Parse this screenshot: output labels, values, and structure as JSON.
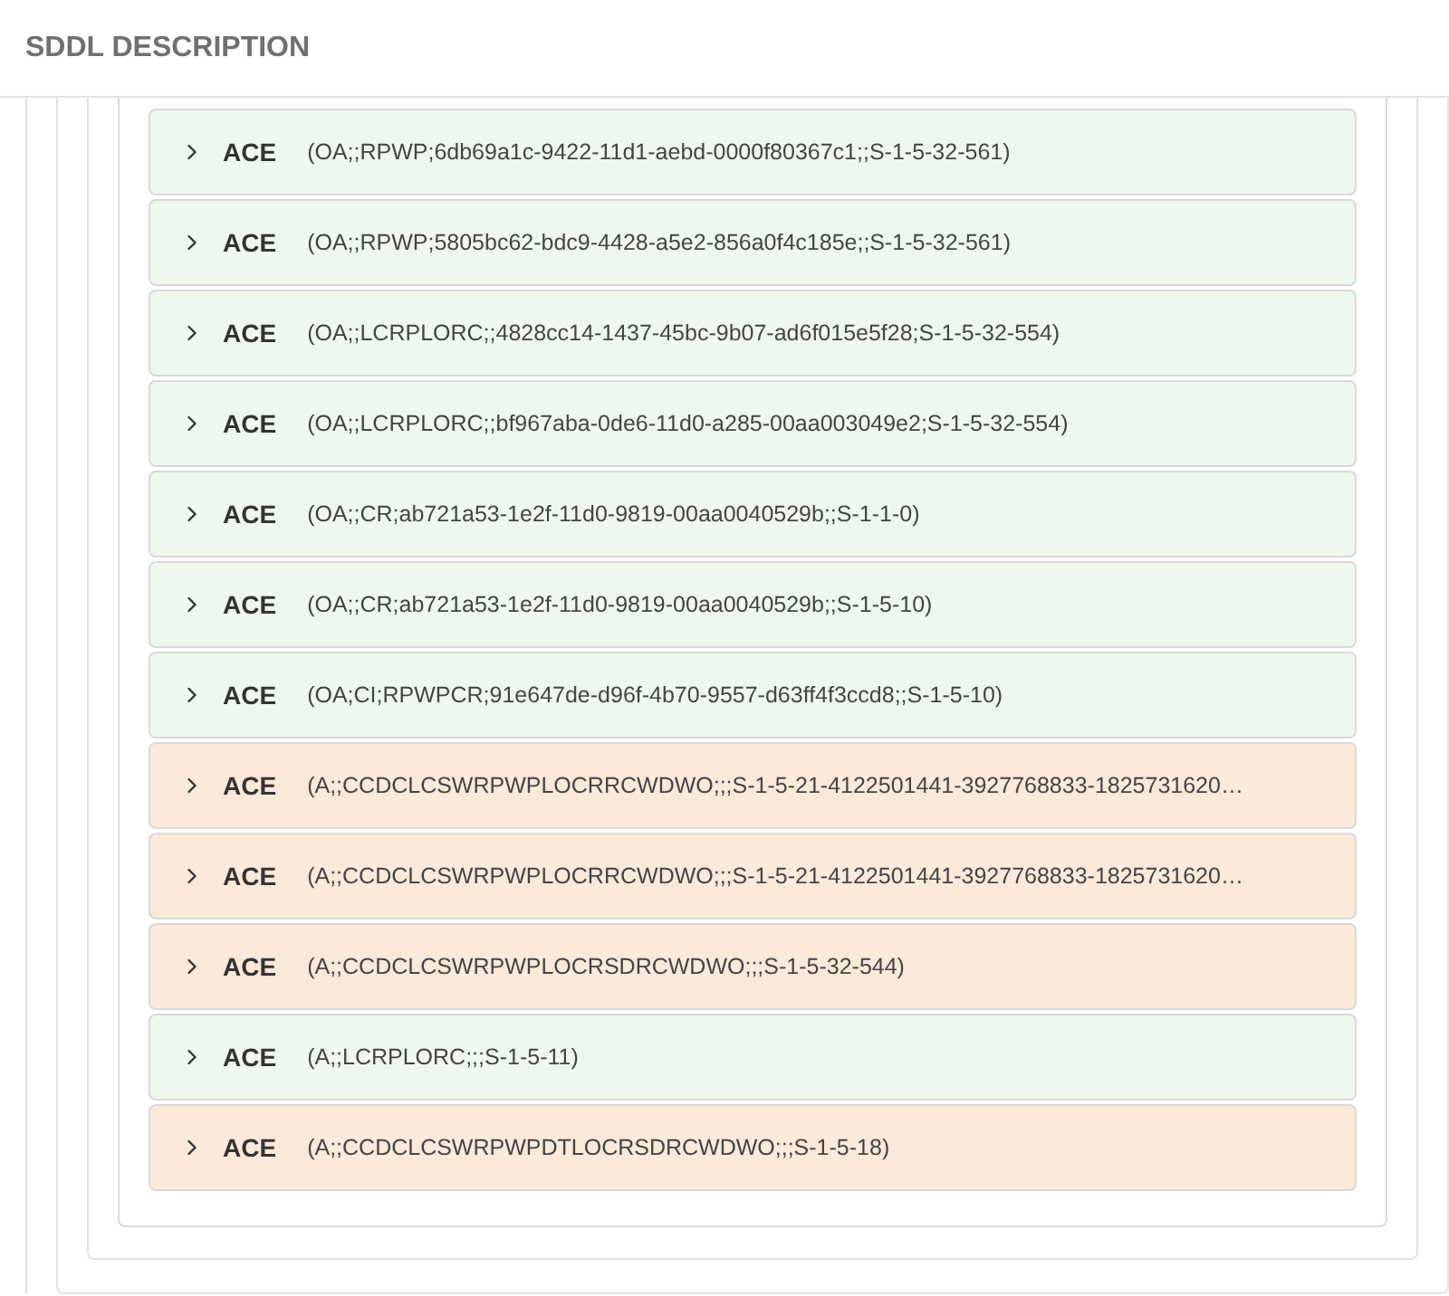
{
  "section": {
    "title": "SDDL DESCRIPTION"
  },
  "aces": [
    {
      "label": "ACE",
      "value": "(OA;;RPWP;6db69a1c-9422-11d1-aebd-0000f80367c1;;S-1-5-32-561)",
      "color": "#eef8ee",
      "expanded": false
    },
    {
      "label": "ACE",
      "value": "(OA;;RPWP;5805bc62-bdc9-4428-a5e2-856a0f4c185e;;S-1-5-32-561)",
      "color": "#eef8ee",
      "expanded": false
    },
    {
      "label": "ACE",
      "value": "(OA;;LCRPLORC;;4828cc14-1437-45bc-9b07-ad6f015e5f28;S-1-5-32-554)",
      "color": "#eef8ee",
      "expanded": false
    },
    {
      "label": "ACE",
      "value": "(OA;;LCRPLORC;;bf967aba-0de6-11d0-a285-00aa003049e2;S-1-5-32-554)",
      "color": "#eef8ee",
      "expanded": false
    },
    {
      "label": "ACE",
      "value": "(OA;;CR;ab721a53-1e2f-11d0-9819-00aa0040529b;;S-1-1-0)",
      "color": "#eef8ee",
      "expanded": false
    },
    {
      "label": "ACE",
      "value": "(OA;;CR;ab721a53-1e2f-11d0-9819-00aa0040529b;;S-1-5-10)",
      "color": "#eef8ee",
      "expanded": false
    },
    {
      "label": "ACE",
      "value": "(OA;CI;RPWPCR;91e647de-d96f-4b70-9557-d63ff4f3ccd8;;S-1-5-10)",
      "color": "#eef8ee",
      "expanded": false
    },
    {
      "label": "ACE",
      "value": "(A;;CCDCLCSWRPWPLOCRRCWDWO;;;S-1-5-21-4122501441-3927768833-1825731620…",
      "color": "#fbe9d9",
      "expanded": false
    },
    {
      "label": "ACE",
      "value": "(A;;CCDCLCSWRPWPLOCRRCWDWO;;;S-1-5-21-4122501441-3927768833-1825731620…",
      "color": "#fbe9d9",
      "expanded": false
    },
    {
      "label": "ACE",
      "value": "(A;;CCDCLCSWRPWPLOCRSDRCWDWO;;;S-1-5-32-544)",
      "color": "#fbe9d9",
      "expanded": false
    },
    {
      "label": "ACE",
      "value": "(A;;LCRPLORC;;;S-1-5-11)",
      "color": "#eef8ee",
      "expanded": false
    },
    {
      "label": "ACE",
      "value": "(A;;CCDCLCSWRPWPDTLOCRSDRCWDWO;;;S-1-5-18)",
      "color": "#fbe9d9",
      "expanded": false
    }
  ]
}
